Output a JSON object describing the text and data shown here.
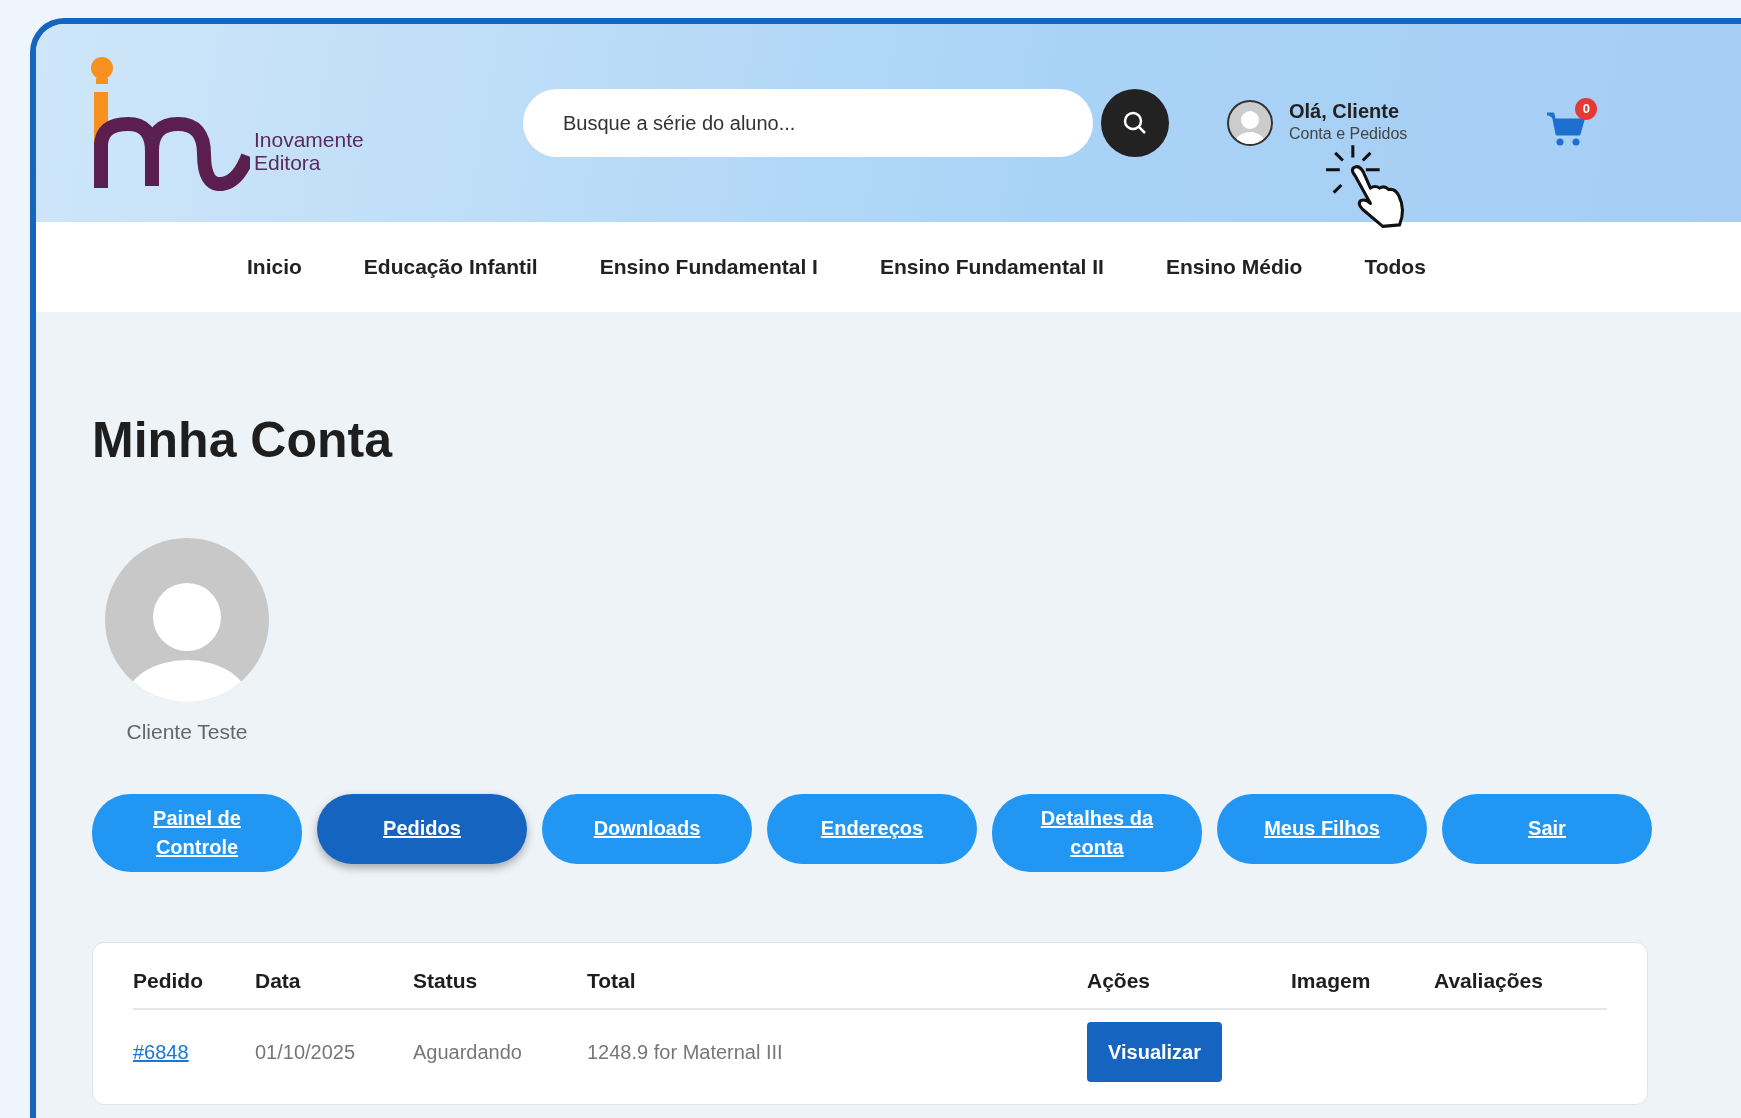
{
  "header": {
    "logo": {
      "line_1": "Inovamente",
      "line_2": "Editora"
    },
    "search": {
      "placeholder": "Busque a série do aluno..."
    },
    "user": {
      "greeting": "Olá, Cliente",
      "subtitle": "Conta e Pedidos"
    },
    "cart": {
      "count": "0"
    }
  },
  "nav": {
    "items": [
      {
        "label": "Inicio"
      },
      {
        "label": "Educação Infantil"
      },
      {
        "label": "Ensino Fundamental I"
      },
      {
        "label": "Ensino Fundamental II"
      },
      {
        "label": "Ensino Médio"
      },
      {
        "label": "Todos"
      }
    ]
  },
  "page_title": "Minha Conta",
  "profile": {
    "name": "Cliente Teste"
  },
  "account_nav": [
    {
      "label": "Painel de Controle",
      "selected": false
    },
    {
      "label": "Pedidos",
      "selected": true
    },
    {
      "label": "Downloads",
      "selected": false
    },
    {
      "label": "Endereços",
      "selected": false
    },
    {
      "label": "Detalhes da conta",
      "selected": false
    },
    {
      "label": "Meus Filhos",
      "selected": false
    },
    {
      "label": "Sair",
      "selected": false
    }
  ],
  "orders": {
    "columns": [
      "Pedido",
      "Data",
      "Status",
      "Total",
      "Ações",
      "Imagem",
      "Avaliações"
    ],
    "rows": [
      {
        "order": "#6848",
        "date": "01/10/2025",
        "status": "Aguardando",
        "total": "1248.9 for Maternal III",
        "action": "Visualizar"
      }
    ]
  }
}
